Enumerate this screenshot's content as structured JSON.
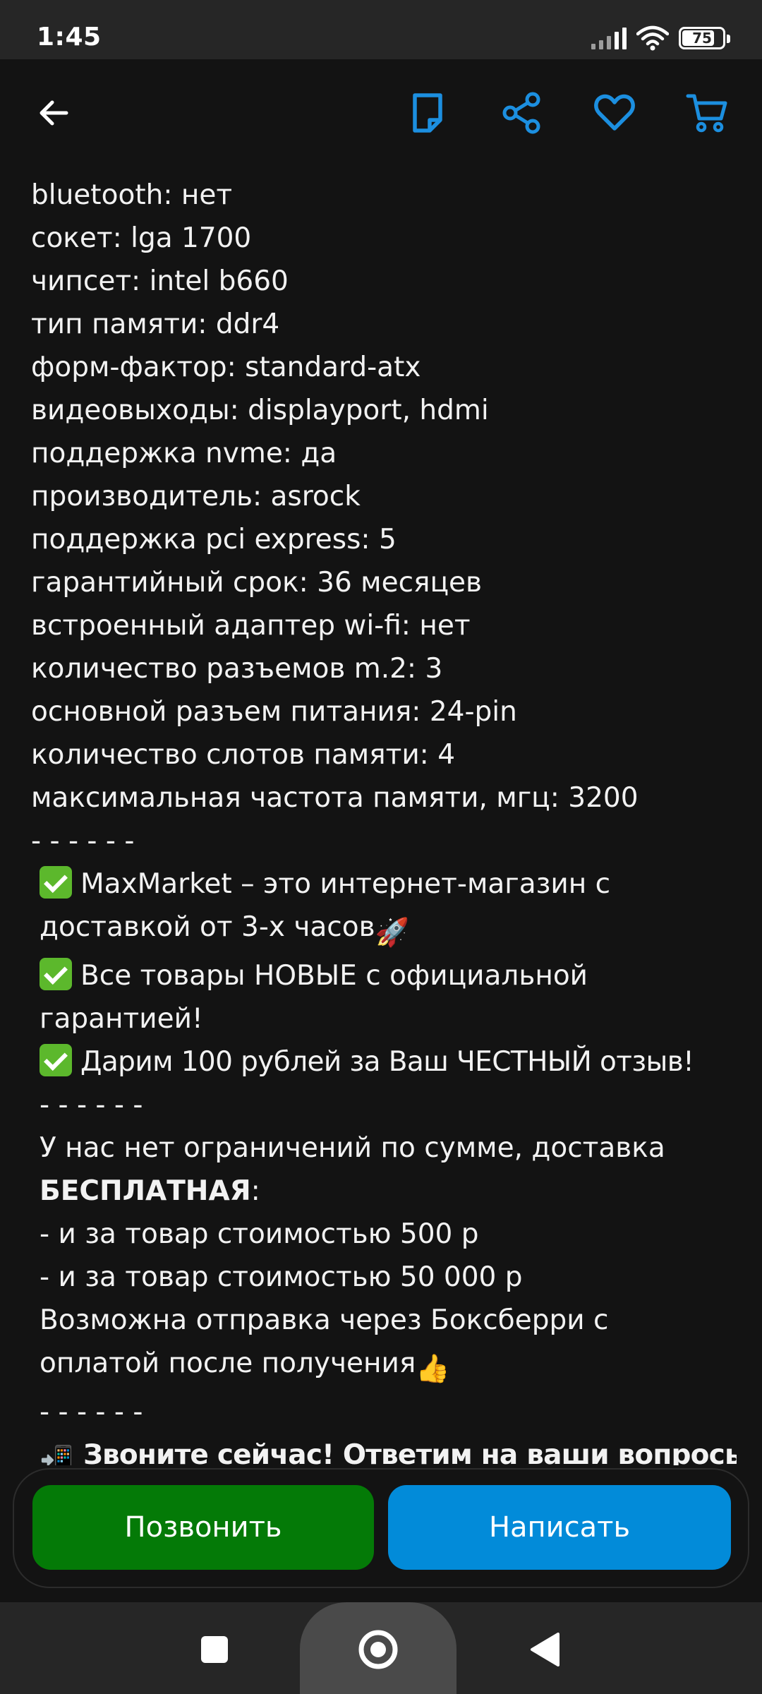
{
  "status_bar": {
    "time": "1:45",
    "battery": "75",
    "icons": [
      "signal-icon",
      "wifi-icon",
      "battery-icon"
    ]
  },
  "toolbar": {
    "icons": [
      "back-arrow-icon",
      "note-icon",
      "share-icon",
      "heart-icon",
      "cart-icon"
    ],
    "accent_color": "#1c8fe0"
  },
  "description": {
    "specs": [
      "bluetooth: нет",
      "сокет: lga 1700",
      "чипсет: intel b660",
      "тип памяти: ddr4",
      "форм-фактор: standard-atx",
      "видеовыходы: displayport, hdmi",
      "поддержка nvme: да",
      "производитель: asrock",
      "поддержка pci express: 5",
      "гарантийный срок: 36 месяцев",
      "встроенный адаптер wi-fi: нет",
      "количество разъемов m.2: 3",
      "основной разъем питания: 24-pin",
      "количество слотов памяти: 4",
      "максимальная частота памяти, мгц: 3200"
    ],
    "divider_1": "- - - - - -",
    "promo_1": "MaxMarket – это интернет-магазин с доставкой от 3-х часов",
    "promo_1_emoji": "🚀",
    "promo_2": "Все товары НОВЫЕ с официальной гарантией!",
    "promo_3": "Дарим 100 рублей за Ваш ЧЕСТНЫЙ отзыв!",
    "divider_2": "- - - - - -",
    "delivery_intro": "У нас нет ограничений по сумме, доставка",
    "delivery_free": "БЕСПЛАТНАЯ",
    "delivery_colon": ":",
    "delivery_item_1": "- и за товар стоимостью 500 р",
    "delivery_item_2": "- и за товар стоимостью 50 000 р",
    "boxberry": "Возможна отправка через Боксберри с оплатой после получения",
    "boxberry_emoji": "👍",
    "divider_3": "- - - - - -",
    "call_now_emoji": "📲",
    "call_now": "Звоните сейчас! Ответим на ваши вопросы!"
  },
  "actions": {
    "call_label": "Позвонить",
    "write_label": "Написать",
    "call_color": "#047a07",
    "write_color": "#028bd9"
  },
  "nav_bar": {
    "icons": [
      "recents-icon",
      "home-icon",
      "back-icon"
    ]
  }
}
